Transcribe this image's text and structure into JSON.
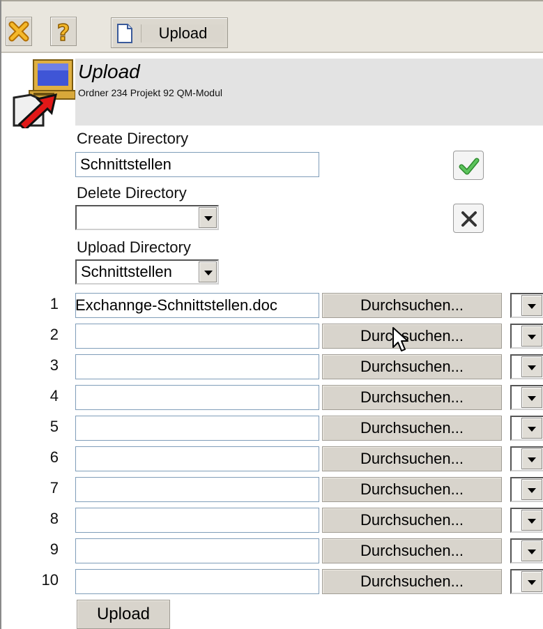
{
  "toolbar": {
    "close_icon": "close-x-icon",
    "help_icon": "question-mark-icon",
    "upload_label": "Upload"
  },
  "header": {
    "title": "Upload",
    "subtitle": "Ordner 234 Projekt 92 QM-Modul"
  },
  "directories": {
    "create_label": "Create Directory",
    "create_value": "Schnittstellen",
    "delete_label": "Delete Directory",
    "delete_value": "",
    "upload_label": "Upload Directory",
    "upload_value": "Schnittstellen"
  },
  "files": {
    "browse_label": "Durchsuchen...",
    "rows": [
      {
        "num": "1",
        "value": "Exchannge-Schnittstellen.doc"
      },
      {
        "num": "2",
        "value": ""
      },
      {
        "num": "3",
        "value": ""
      },
      {
        "num": "4",
        "value": ""
      },
      {
        "num": "5",
        "value": ""
      },
      {
        "num": "6",
        "value": ""
      },
      {
        "num": "7",
        "value": ""
      },
      {
        "num": "8",
        "value": ""
      },
      {
        "num": "9",
        "value": ""
      },
      {
        "num": "10",
        "value": ""
      }
    ]
  },
  "submit_label": "Upload",
  "colors": {
    "toolbar_bg": "#e9e6de",
    "header_bg": "#e3e3e3",
    "button_bg": "#d8d4cc",
    "confirm_green": "#3aa640",
    "close_orange": "#e8a21a"
  }
}
